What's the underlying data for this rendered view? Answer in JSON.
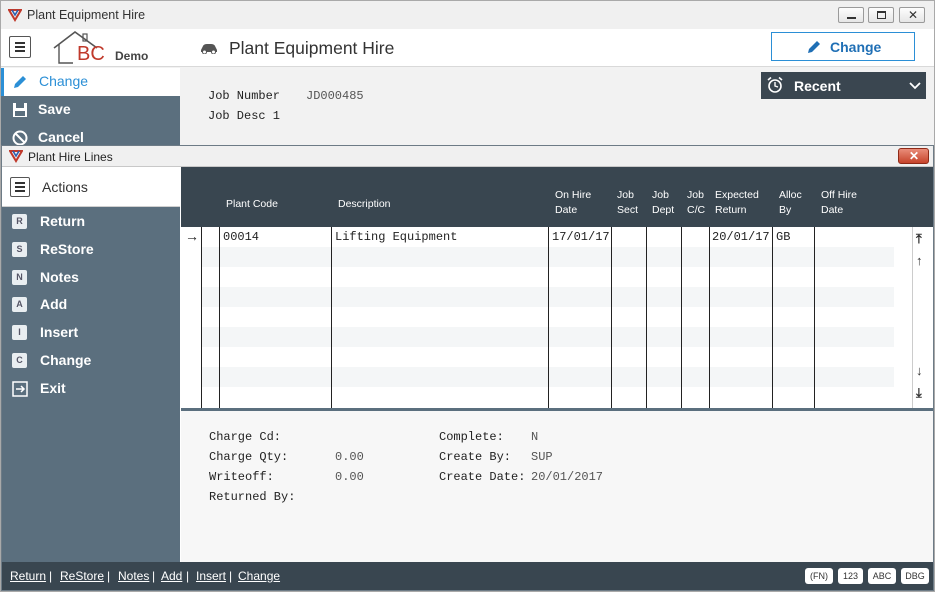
{
  "outer": {
    "title": "Plant Equipment Hire",
    "logo_text": "BC",
    "logo_sub": "Demo",
    "header_title": "Plant Equipment Hire",
    "change_label": "Change",
    "sidebar": [
      {
        "label": "Change",
        "icon": "pencil-icon",
        "active": true
      },
      {
        "label": "Save",
        "icon": "floppy-icon"
      },
      {
        "label": "Cancel",
        "icon": "cancel-icon"
      }
    ],
    "job_number_label": "Job Number",
    "job_number_value": "JD000485",
    "job_desc_label": "Job Desc 1",
    "recent_label": "Recent"
  },
  "inner": {
    "title": "Plant Hire Lines",
    "actions_label": "Actions",
    "actions": [
      {
        "key": "R",
        "label": "Return"
      },
      {
        "key": "S",
        "label": "ReStore"
      },
      {
        "key": "N",
        "label": "Notes"
      },
      {
        "key": "A",
        "label": "Add"
      },
      {
        "key": "I",
        "label": "Insert"
      },
      {
        "key": "C",
        "label": "Change"
      },
      {
        "key": "",
        "label": "Exit"
      }
    ],
    "grid": {
      "columns": [
        {
          "line1": "",
          "line2": "Plant Code"
        },
        {
          "line1": "",
          "line2": "Description"
        },
        {
          "line1": "On Hire",
          "line2": "Date"
        },
        {
          "line1": "Job",
          "line2": "Sect"
        },
        {
          "line1": "Job",
          "line2": "Dept"
        },
        {
          "line1": "Job",
          "line2": "C/C"
        },
        {
          "line1": "Expected",
          "line2": "Return"
        },
        {
          "line1": "Alloc",
          "line2": "By"
        },
        {
          "line1": "Off Hire",
          "line2": "Date"
        }
      ],
      "rows": [
        {
          "plant_code": "00014",
          "description": "Lifting Equipment",
          "on_hire": "17/01/17",
          "sect": "",
          "dept": "",
          "cc": "",
          "expected": "20/01/17",
          "alloc": "GB",
          "off_hire": ""
        }
      ]
    },
    "detail": {
      "charge_cd_label": "Charge Cd:",
      "charge_cd_value": "",
      "charge_qty_label": "Charge Qty:",
      "charge_qty_value": "0.00",
      "writeoff_label": "Writeoff:",
      "writeoff_value": "0.00",
      "returned_by_label": "Returned By:",
      "returned_by_value": "",
      "complete_label": "Complete:",
      "complete_value": "N",
      "create_by_label": "Create By:",
      "create_by_value": "SUP",
      "create_date_label": "Create Date:",
      "create_date_value": "20/01/2017"
    },
    "status_links": [
      "Return",
      "ReStore",
      "Notes",
      "Add",
      "Insert",
      "Change"
    ],
    "badges": [
      "(FN)",
      "123",
      "ABC",
      "DBG"
    ]
  },
  "colors": {
    "sidebar": "#5b6f7e",
    "dark_header": "#394650",
    "accent": "#2b8fd6",
    "logo_red": "#c0392b"
  }
}
